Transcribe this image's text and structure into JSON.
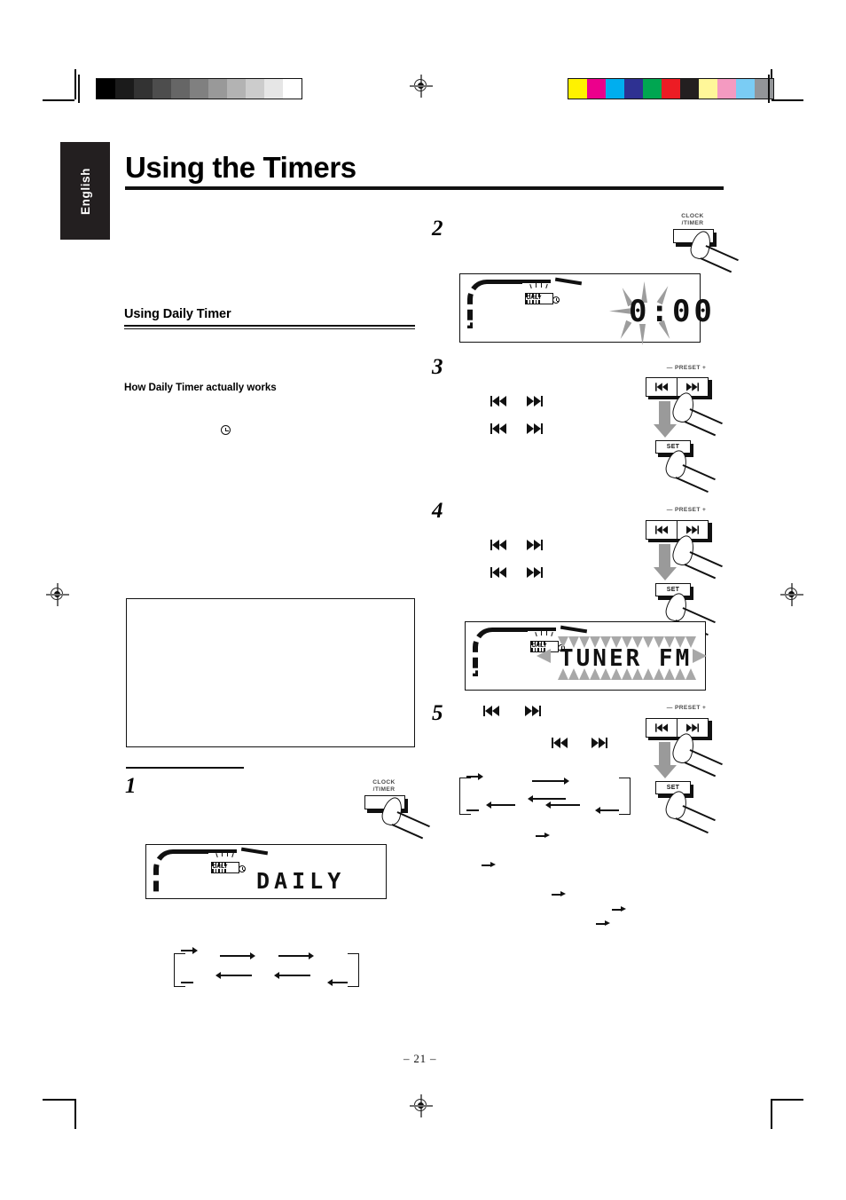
{
  "page": {
    "language_tab": "English",
    "title": "Using the Timers",
    "page_number": "– 21 –"
  },
  "section": {
    "heading": "Using Daily Timer",
    "subheading": "How Daily Timer actually works"
  },
  "steps": [
    {
      "number": "1"
    },
    {
      "number": "2"
    },
    {
      "number": "3"
    },
    {
      "number": "4"
    },
    {
      "number": "5"
    }
  ],
  "displays": {
    "step1": {
      "indicator": "DAILY",
      "readout": "DAILY",
      "flashing": "true"
    },
    "step2": {
      "indicator": "DAILY",
      "readout": "0:00",
      "flashing": "true"
    },
    "step4": {
      "indicator": "DAILY",
      "readout": "TUNER  FM",
      "flashing": "true"
    }
  },
  "controls": {
    "clock_timer_line1": "CLOCK",
    "clock_timer_line2": "/TIMER",
    "preset_label": "— PRESET +",
    "set_label": "SET",
    "prev_icon": "skip-back-icon",
    "next_icon": "skip-forward-icon"
  },
  "icons": {
    "timer_clock": "clock-icon",
    "registration": "registration-mark-icon"
  },
  "calibration": {
    "grayscale": [
      "#000000",
      "#1b1b1b",
      "#333333",
      "#4d4d4d",
      "#666666",
      "#808080",
      "#999999",
      "#b3b3b3",
      "#cccccc",
      "#e6e6e6",
      "#ffffff"
    ],
    "color": [
      "#fff200",
      "#ec008c",
      "#00aeef",
      "#2e3192",
      "#00a651",
      "#ed1c24",
      "#231f20",
      "#fff799",
      "#f49ac1",
      "#7accf4",
      "#939598"
    ]
  }
}
